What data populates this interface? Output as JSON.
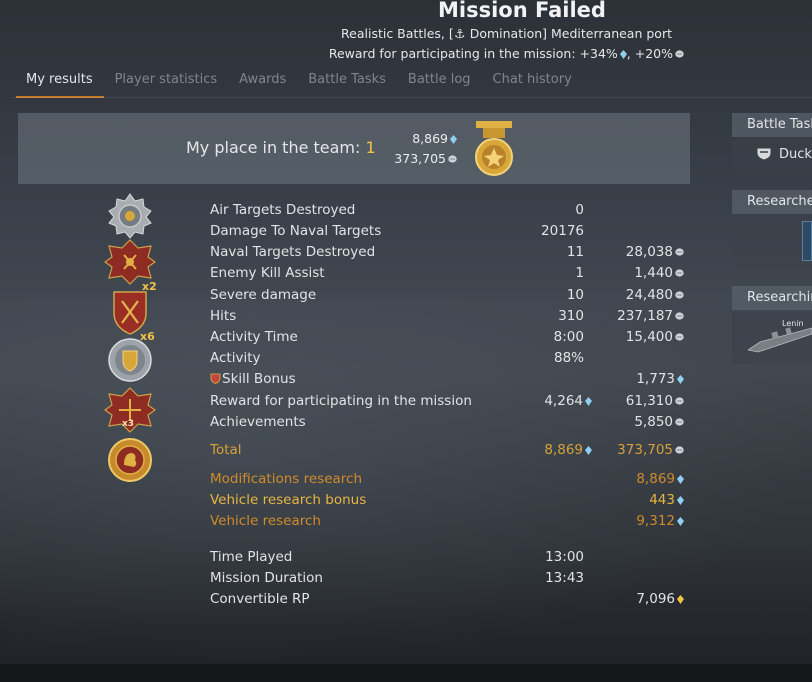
{
  "header": {
    "title": "Mission Failed",
    "subtitle_prefix": "Realistic Battles, [",
    "subtitle_suffix": " Domination] Mediterranean port",
    "reward_line_prefix": "Reward for participating in the mission: +34%",
    "reward_line_mid": ", +20%"
  },
  "tabs": [
    {
      "label": "My results",
      "active": true
    },
    {
      "label": "Player statistics",
      "active": false
    },
    {
      "label": "Awards",
      "active": false
    },
    {
      "label": "Battle Tasks",
      "active": false
    },
    {
      "label": "Battle log",
      "active": false
    },
    {
      "label": "Chat history",
      "active": false
    }
  ],
  "place": {
    "label": "My place in the team: ",
    "value": "1",
    "rp": "8,869",
    "sl": "373,705"
  },
  "awards": [
    {
      "icon": "air-target-medal-icon",
      "badge": ""
    },
    {
      "icon": "naval-cross-icon",
      "badge": "x2"
    },
    {
      "icon": "shield-swords-icon",
      "badge": "x6"
    },
    {
      "icon": "silver-shield-medal-icon",
      "badge": ""
    },
    {
      "icon": "red-cross-medal-icon",
      "badge": "x3"
    },
    {
      "icon": "gold-lion-medal-icon",
      "badge": ""
    }
  ],
  "results": {
    "rows": [
      {
        "label": "Air Targets Destroyed",
        "c1": "0",
        "c2": ""
      },
      {
        "label": "Damage To Naval Targets",
        "c1": "20176",
        "c2": ""
      },
      {
        "label": "Naval Targets Destroyed",
        "c1": "11",
        "c2": "28,038"
      },
      {
        "label": "Enemy Kill Assist",
        "c1": "1",
        "c2": "1,440"
      },
      {
        "label": "Severe damage",
        "c1": "10",
        "c2": "24,480"
      },
      {
        "label": "Hits",
        "c1": "310",
        "c2": "237,187"
      },
      {
        "label": "Activity Time",
        "c1": "8:00",
        "c2": "15,400"
      },
      {
        "label": "Activity",
        "c1": "88%",
        "c2": ""
      },
      {
        "label": "Skill Bonus",
        "c1": "",
        "c2": "1,773"
      },
      {
        "label": "Reward for participating in the mission",
        "c1": "4,264",
        "c2": "61,310"
      },
      {
        "label": "Achievements",
        "c1": "",
        "c2": "5,850"
      }
    ],
    "total": {
      "label": "Total",
      "rp": "8,869",
      "sl": "373,705"
    },
    "research": [
      {
        "label": "Modifications research",
        "value": "8,869"
      },
      {
        "label": "Vehicle research bonus",
        "value": "443"
      },
      {
        "label": "Vehicle research",
        "value": "9,312"
      }
    ],
    "time": [
      {
        "label": "Time Played",
        "value": "13:00"
      },
      {
        "label": "Mission Duration",
        "value": "13:43"
      },
      {
        "label": "Convertible RP",
        "value": "7,096"
      }
    ]
  },
  "sidebar": {
    "battle_tasks_title": "Battle Tasks",
    "task_name": "Duck",
    "researched_title": "Researched",
    "researching_title": "Researching",
    "researching_vehicle": "Lenin"
  },
  "colors": {
    "accent_tab": "#c47a2a",
    "gold_text": "#d6a13a",
    "place_highlight": "#f2c444",
    "rp_icon": "#8fd0f0",
    "convertible_rp_icon": "#f2c444"
  }
}
